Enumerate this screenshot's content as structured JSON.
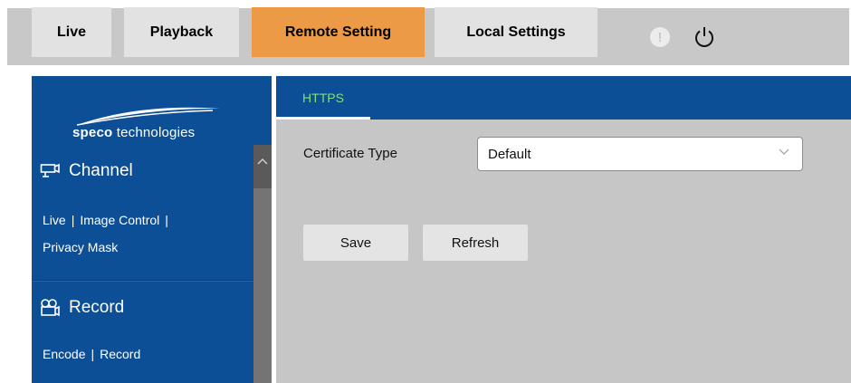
{
  "nav": {
    "tabs": [
      {
        "label": "Live"
      },
      {
        "label": "Playback"
      },
      {
        "label": "Remote Setting"
      },
      {
        "label": "Local Settings"
      }
    ],
    "active_tab": "Remote Setting",
    "icons": [
      "alert-icon",
      "power-icon"
    ],
    "alert_glyph": "!"
  },
  "sidebar": {
    "logo": {
      "brand": "speco",
      "suffix": " technologies"
    },
    "sections": [
      {
        "title": "Channel",
        "icon": "camera-icon",
        "links": [
          "Live",
          "Image Control",
          "Privacy Mask"
        ]
      },
      {
        "title": "Record",
        "icon": "recorder-icon",
        "links": [
          "Encode",
          "Record"
        ]
      }
    ],
    "separator": "|"
  },
  "content": {
    "tab": "HTTPS",
    "certificate": {
      "label": "Certificate Type",
      "value": "Default"
    },
    "buttons": {
      "save": "Save",
      "refresh": "Refresh"
    }
  },
  "colors": {
    "accent": "#ec9a45",
    "sidebar": "#0d4f97",
    "active_subtab_text": "#7ee07e",
    "content_bg": "#c6c6c6"
  }
}
